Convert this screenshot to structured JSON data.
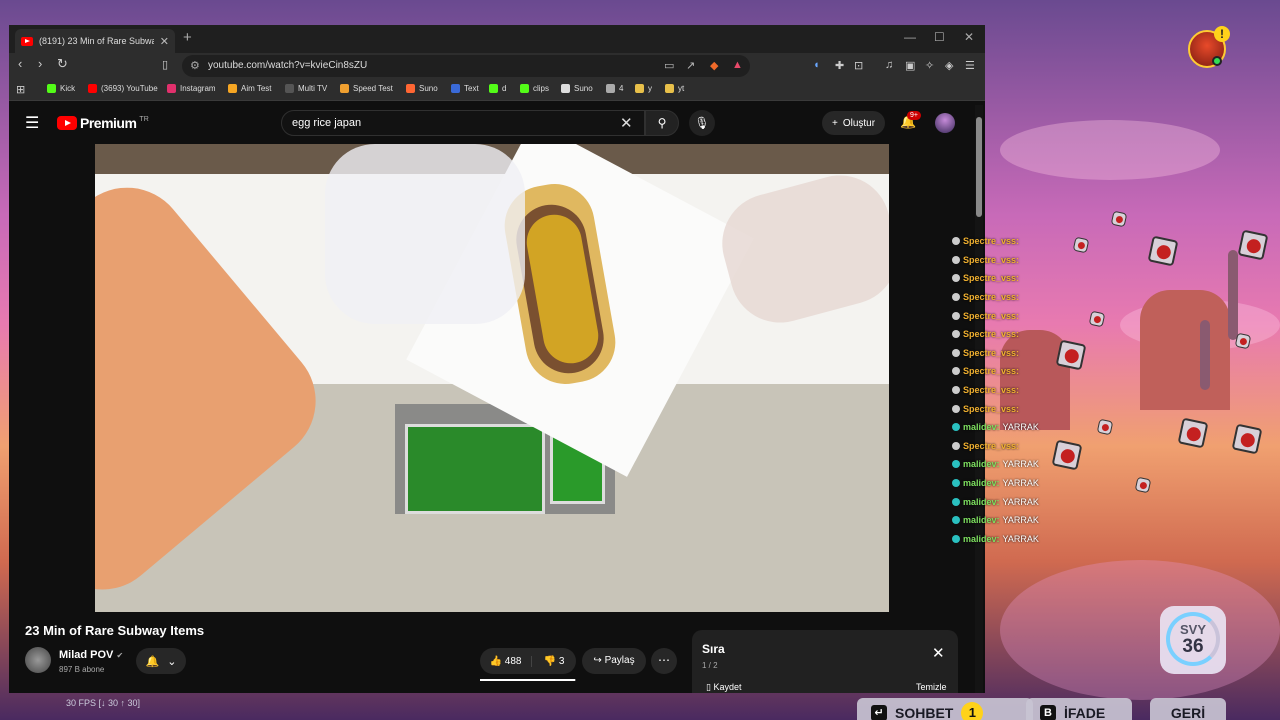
{
  "browser": {
    "tab_title": "(8191) 23 Min of Rare Subway Items",
    "url": "youtube.com/watch?v=kvieCin8sZU",
    "bookmarks": [
      {
        "label": "Kick",
        "color": "#53fc18"
      },
      {
        "label": "(3693) YouTube",
        "color": "#ff0000"
      },
      {
        "label": "Instagram",
        "color": "#e1306c"
      },
      {
        "label": "Aim Test",
        "color": "#f6a623"
      },
      {
        "label": "Multi TV",
        "color": "#555555"
      },
      {
        "label": "Speed Test",
        "color": "#f0a030"
      },
      {
        "label": "Suno",
        "color": "#ff6633"
      },
      {
        "label": "Text",
        "color": "#3a6ad8"
      },
      {
        "label": "d",
        "color": "#53fc18"
      },
      {
        "label": "clips",
        "color": "#53fc18"
      },
      {
        "label": "Suno",
        "color": "#dddddd"
      },
      {
        "label": "4",
        "color": "#aaaaaa"
      },
      {
        "label": "y",
        "color": "#e8c04a"
      },
      {
        "label": "yt",
        "color": "#e8c04a"
      }
    ]
  },
  "youtube": {
    "logo_text": "Premium",
    "logo_region": "TR",
    "search_value": "egg rice japan",
    "create_label": "Oluştur",
    "notif_count": "9+",
    "video_title": "23 Min of Rare Subway Items",
    "channel_name": "Milad POV",
    "channel_subs": "897 B abone",
    "likes": "488",
    "dislikes": "3",
    "share_label": "Paylaş",
    "like_ratio": 0.99
  },
  "queue": {
    "title": "Sıra",
    "count": "1 / 2",
    "save_label": "Kaydet",
    "clear_label": "Temizle"
  },
  "chat": [
    {
      "user": "Spectre_vss:",
      "msg": "",
      "color": "#f0b030"
    },
    {
      "user": "Spectre_vss:",
      "msg": "",
      "color": "#f0b030"
    },
    {
      "user": "Spectre_vss:",
      "msg": "",
      "color": "#f0b030"
    },
    {
      "user": "Spectre_vss:",
      "msg": "",
      "color": "#f0b030"
    },
    {
      "user": "Spectre_vss:",
      "msg": "",
      "color": "#f0b030"
    },
    {
      "user": "Spectre_vss:",
      "msg": "",
      "color": "#f0b030"
    },
    {
      "user": "Spectre_vss:",
      "msg": "",
      "color": "#f0b030"
    },
    {
      "user": "Spectre_vss:",
      "msg": "",
      "color": "#f0b030"
    },
    {
      "user": "Spectre_vss:",
      "msg": "",
      "color": "#f0b030"
    },
    {
      "user": "Spectre_vss:",
      "msg": "",
      "color": "#f0b030"
    },
    {
      "user": "malidev:",
      "msg": "YARRAK",
      "color": "#7ee060"
    },
    {
      "user": "Spectre_vss:",
      "msg": "",
      "color": "#f0b030"
    },
    {
      "user": "malidev:",
      "msg": "YARRAK",
      "color": "#7ee060"
    },
    {
      "user": "malidev:",
      "msg": "YARRAK",
      "color": "#7ee060"
    },
    {
      "user": "malidev:",
      "msg": "YARRAK",
      "color": "#7ee060"
    },
    {
      "user": "malidev:",
      "msg": "YARRAK",
      "color": "#7ee060"
    },
    {
      "user": "malidev:",
      "msg": "YARRAK",
      "color": "#7ee060"
    }
  ],
  "game_hud": {
    "alert": "!",
    "level_label": "SVY",
    "level_value": "36",
    "chat_button": "SOHBET",
    "chat_key": "↵",
    "chat_count": "1",
    "emote_button": "İFADE",
    "emote_key": "B",
    "back_button": "GERİ",
    "fps": "30 FPS [↓ 30 ↑ 30]"
  }
}
